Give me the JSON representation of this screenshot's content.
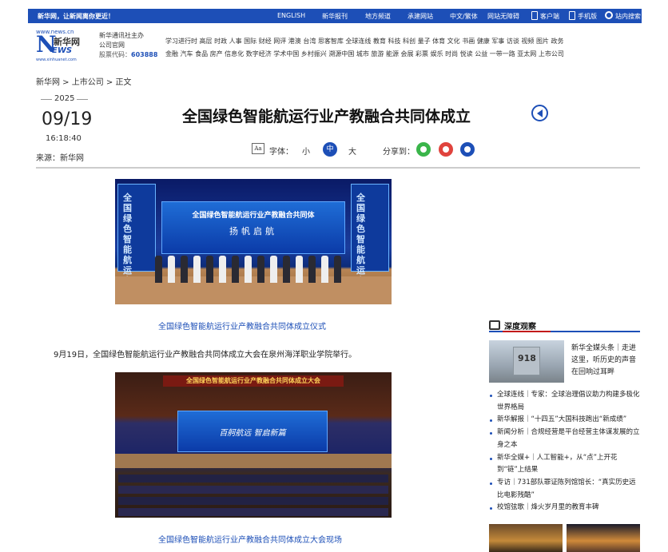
{
  "topbar": {
    "slogan": "新华网，让新闻离你更近！",
    "nav": [
      "ENGLISH",
      "新华报刊",
      "地方频道",
      "承建网站",
      "中文/繁体",
      "网站无障碍",
      "客户端",
      "手机版",
      "站内搜索"
    ],
    "bg": "#1d4fb7"
  },
  "header": {
    "logo_url": "www.news.cn",
    "logo_n": "N",
    "logo_cn": "新华网",
    "logo_ews": "EWS",
    "logo_sub": "www.xinhuanet.com",
    "corp_line1": "新华通讯社主办",
    "corp_line2": "公司官网",
    "corp_code_label": "股票代码：",
    "corp_code": "603888",
    "channels_row1": "学习进行时 高层 时政 人事 国际 财经 网评 港澳 台湾 思客智库 全球连线 教育 科技 科创 量子 体育 文化 书画 健康 军事 访谈 视频 图片 政务",
    "channels_row2": "金融 汽车 食品 房产 信息化 数字经济 学术中国 乡村振兴 溯源中国 城市 旅游 能源 会展 彩票 娱乐 时尚 悦读 公益 一带一路 亚太网 上市公司"
  },
  "breadcrumb": "新华网 > 上市公司 > 正文",
  "article": {
    "year": "2025",
    "date": "09/19",
    "time": "16:18:40",
    "source": "来源：新华网",
    "title": "全国绿色智能航运行业产教融合共同体成立",
    "font_label": "字体：",
    "font_small": "小",
    "font_mid": "中",
    "font_big": "大",
    "share_label": "分享到：",
    "img1_screen_title": "全国绿色智能航运行业产教融合共同体",
    "img1_screen_sub": "扬帆启航",
    "img1_pillar_left": "全国绿色智能航运产教融合共同体扬帆启航",
    "img1_pillar_right": "全国绿色智能航运产教融合共同体扬帆启航",
    "caption1": "全国绿色智能航运行业产教融合共同体成立仪式",
    "paragraph": "9月19日，全国绿色智能航运行业产教融合共同体成立大会在泉州海洋职业学院举行。",
    "img2_banner": "全国绿色智能航运行业产教融合共同体成立大会",
    "img2_screen": "百舸航远  智启新篇",
    "caption2": "全国绿色智能航运行业产教融合共同体成立大会现场"
  },
  "sidebar": {
    "heading": "深度观察",
    "feature_text": "新华全媒头条｜走进这里，听历史的声音在回响过耳畔",
    "feature_img_text": "918",
    "news": [
      "全球连线｜专家：全球治理倡议助力构建多极化世界格局",
      "新华解报｜“十四五”大国科技跑出“新成绩”",
      "新闻分析｜合规经营是平台经营主体谋发展的立身之本",
      "新华全媒+｜人工智能+，从“点”上开花到“链”上结果",
      "专访｜731部队罪证陈列馆馆长：“真实历史远比电影残酷”",
      "校馆弦歌｜烽火岁月里的教育丰碑"
    ]
  }
}
